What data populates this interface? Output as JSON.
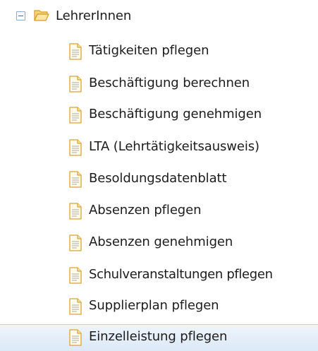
{
  "tree": {
    "folder": {
      "label": "LehrerInnen",
      "toggle_icon": "collapse-minus-icon",
      "icon": "folder-open-icon",
      "expanded": true
    },
    "items": [
      {
        "label": "Tätigkeiten pflegen",
        "icon": "document-icon"
      },
      {
        "label": "Beschäftigung berechnen",
        "icon": "document-icon"
      },
      {
        "label": "Beschäftigung genehmigen",
        "icon": "document-icon"
      },
      {
        "label": "LTA (Lehrtätigkeitsausweis)",
        "icon": "document-icon"
      },
      {
        "label": "Besoldungsdatenblatt",
        "icon": "document-icon"
      },
      {
        "label": "Absenzen pflegen",
        "icon": "document-icon"
      },
      {
        "label": "Absenzen genehmigen",
        "icon": "document-icon"
      },
      {
        "label": "Schulveranstaltungen pflegen",
        "icon": "document-icon"
      },
      {
        "label": "Supplierplan pflegen",
        "icon": "document-icon"
      },
      {
        "label": "Einzelleistung pflegen",
        "icon": "document-icon",
        "selected": true
      }
    ]
  },
  "colors": {
    "selected_background": "#dce9f7",
    "folder": "#f2b233",
    "document": "#e9b54a"
  }
}
